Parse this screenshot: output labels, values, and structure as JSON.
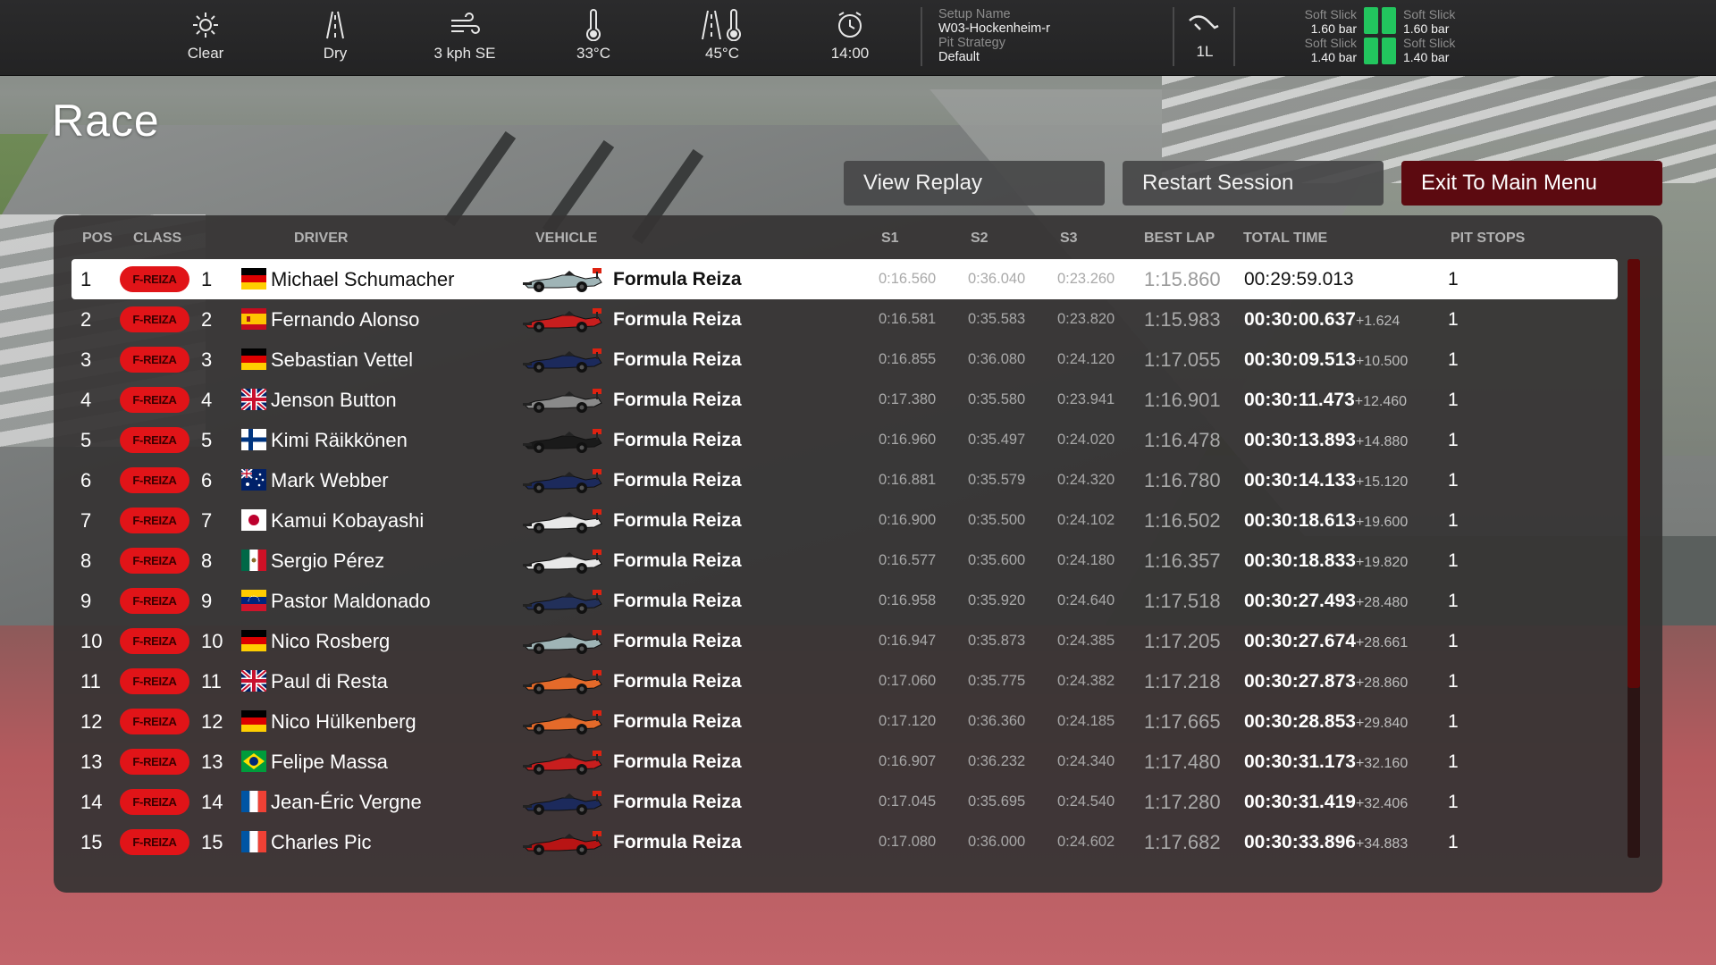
{
  "topbar": {
    "weather": [
      {
        "icon": "sun-icon",
        "label": "Clear"
      },
      {
        "icon": "road-dry-icon",
        "label": "Dry"
      },
      {
        "icon": "wind-icon",
        "label": "3 kph  SE"
      },
      {
        "icon": "air-temperature-icon",
        "label": "33°C"
      },
      {
        "icon": "track-temperature-icon",
        "label": "45°C"
      },
      {
        "icon": "clock-icon",
        "label": "14:00"
      }
    ],
    "setup": {
      "name_key": "Setup Name",
      "name_value": "W03-Hockenheim-r",
      "strategy_key": "Pit Strategy",
      "strategy_value": "Default"
    },
    "fuel": {
      "icon": "fuel-icon",
      "label": "1L"
    },
    "tyres": [
      {
        "compound": "Soft Slick",
        "pressure": "1.60 bar"
      },
      {
        "compound": "Soft Slick",
        "pressure": "1.60 bar"
      },
      {
        "compound": "Soft Slick",
        "pressure": "1.40 bar"
      },
      {
        "compound": "Soft Slick",
        "pressure": "1.40 bar"
      }
    ],
    "tyre_color": "#22c55e"
  },
  "page": {
    "title": "Race"
  },
  "buttons": {
    "view_replay": "View Replay",
    "restart_session": "Restart Session",
    "exit": "Exit To Main Menu"
  },
  "table": {
    "headers": {
      "pos": "POS",
      "class": "CLASS",
      "driver": "DRIVER",
      "vehicle": "VEHICLE",
      "s1": "S1",
      "s2": "S2",
      "s3": "S3",
      "best": "BEST LAP",
      "total": "TOTAL TIME",
      "pit": "PIT STOPS"
    },
    "class_color": "#e11418",
    "rows": [
      {
        "pos": "1",
        "class": "F-REIZA",
        "num": "1",
        "flag": "de",
        "driver": "Michael Schumacher",
        "car": "#9fb4b6",
        "vehicle": "Formula Reiza",
        "s1": "0:16.560",
        "s2": "0:36.040",
        "s3": "0:23.260",
        "best": "1:15.860",
        "total": "00:29:59.013",
        "gap": "",
        "pit": "1"
      },
      {
        "pos": "2",
        "class": "F-REIZA",
        "num": "2",
        "flag": "es",
        "driver": "Fernando Alonso",
        "car": "#c81e1e",
        "vehicle": "Formula Reiza",
        "s1": "0:16.581",
        "s2": "0:35.583",
        "s3": "0:23.820",
        "best": "1:15.983",
        "total": "00:30:00.637",
        "gap": "+1.624",
        "pit": "1"
      },
      {
        "pos": "3",
        "class": "F-REIZA",
        "num": "3",
        "flag": "de",
        "driver": "Sebastian Vettel",
        "car": "#1c2a5c",
        "vehicle": "Formula Reiza",
        "s1": "0:16.855",
        "s2": "0:36.080",
        "s3": "0:24.120",
        "best": "1:17.055",
        "total": "00:30:09.513",
        "gap": "+10.500",
        "pit": "1"
      },
      {
        "pos": "4",
        "class": "F-REIZA",
        "num": "4",
        "flag": "gb",
        "driver": "Jenson Button",
        "car": "#8a8a8a",
        "vehicle": "Formula Reiza",
        "s1": "0:17.380",
        "s2": "0:35.580",
        "s3": "0:23.941",
        "best": "1:16.901",
        "total": "00:30:11.473",
        "gap": "+12.460",
        "pit": "1"
      },
      {
        "pos": "5",
        "class": "F-REIZA",
        "num": "5",
        "flag": "fi",
        "driver": "Kimi Räikkönen",
        "car": "#1a1a1a",
        "vehicle": "Formula Reiza",
        "s1": "0:16.960",
        "s2": "0:35.497",
        "s3": "0:24.020",
        "best": "1:16.478",
        "total": "00:30:13.893",
        "gap": "+14.880",
        "pit": "1"
      },
      {
        "pos": "6",
        "class": "F-REIZA",
        "num": "6",
        "flag": "au",
        "driver": "Mark Webber",
        "car": "#1c2a5c",
        "vehicle": "Formula Reiza",
        "s1": "0:16.881",
        "s2": "0:35.579",
        "s3": "0:24.320",
        "best": "1:16.780",
        "total": "00:30:14.133",
        "gap": "+15.120",
        "pit": "1"
      },
      {
        "pos": "7",
        "class": "F-REIZA",
        "num": "7",
        "flag": "jp",
        "driver": "Kamui Kobayashi",
        "car": "#e8e8e8",
        "vehicle": "Formula Reiza",
        "s1": "0:16.900",
        "s2": "0:35.500",
        "s3": "0:24.102",
        "best": "1:16.502",
        "total": "00:30:18.613",
        "gap": "+19.600",
        "pit": "1"
      },
      {
        "pos": "8",
        "class": "F-REIZA",
        "num": "8",
        "flag": "mx",
        "driver": "Sergio Pérez",
        "car": "#e8e8e8",
        "vehicle": "Formula Reiza",
        "s1": "0:16.577",
        "s2": "0:35.600",
        "s3": "0:24.180",
        "best": "1:16.357",
        "total": "00:30:18.833",
        "gap": "+19.820",
        "pit": "1"
      },
      {
        "pos": "9",
        "class": "F-REIZA",
        "num": "9",
        "flag": "ve",
        "driver": "Pastor Maldonado",
        "car": "#22305a",
        "vehicle": "Formula Reiza",
        "s1": "0:16.958",
        "s2": "0:35.920",
        "s3": "0:24.640",
        "best": "1:17.518",
        "total": "00:30:27.493",
        "gap": "+28.480",
        "pit": "1"
      },
      {
        "pos": "10",
        "class": "F-REIZA",
        "num": "10",
        "flag": "de",
        "driver": "Nico Rosberg",
        "car": "#9fb4b6",
        "vehicle": "Formula Reiza",
        "s1": "0:16.947",
        "s2": "0:35.873",
        "s3": "0:24.385",
        "best": "1:17.205",
        "total": "00:30:27.674",
        "gap": "+28.661",
        "pit": "1"
      },
      {
        "pos": "11",
        "class": "F-REIZA",
        "num": "11",
        "flag": "gb",
        "driver": "Paul di Resta",
        "car": "#e46a2a",
        "vehicle": "Formula Reiza",
        "s1": "0:17.060",
        "s2": "0:35.775",
        "s3": "0:24.382",
        "best": "1:17.218",
        "total": "00:30:27.873",
        "gap": "+28.860",
        "pit": "1"
      },
      {
        "pos": "12",
        "class": "F-REIZA",
        "num": "12",
        "flag": "de",
        "driver": "Nico Hülkenberg",
        "car": "#e46a2a",
        "vehicle": "Formula Reiza",
        "s1": "0:17.120",
        "s2": "0:36.360",
        "s3": "0:24.185",
        "best": "1:17.665",
        "total": "00:30:28.853",
        "gap": "+29.840",
        "pit": "1"
      },
      {
        "pos": "13",
        "class": "F-REIZA",
        "num": "13",
        "flag": "br",
        "driver": "Felipe Massa",
        "car": "#c81e1e",
        "vehicle": "Formula Reiza",
        "s1": "0:16.907",
        "s2": "0:36.232",
        "s3": "0:24.340",
        "best": "1:17.480",
        "total": "00:30:31.173",
        "gap": "+32.160",
        "pit": "1"
      },
      {
        "pos": "14",
        "class": "F-REIZA",
        "num": "14",
        "flag": "fr",
        "driver": "Jean-Éric Vergne",
        "car": "#1c2a5c",
        "vehicle": "Formula Reiza",
        "s1": "0:17.045",
        "s2": "0:35.695",
        "s3": "0:24.540",
        "best": "1:17.280",
        "total": "00:30:31.419",
        "gap": "+32.406",
        "pit": "1"
      },
      {
        "pos": "15",
        "class": "F-REIZA",
        "num": "15",
        "flag": "fr",
        "driver": "Charles Pic",
        "car": "#b81414",
        "vehicle": "Formula Reiza",
        "s1": "0:17.080",
        "s2": "0:36.000",
        "s3": "0:24.602",
        "best": "1:17.682",
        "total": "00:30:33.896",
        "gap": "+34.883",
        "pit": "1"
      }
    ]
  }
}
